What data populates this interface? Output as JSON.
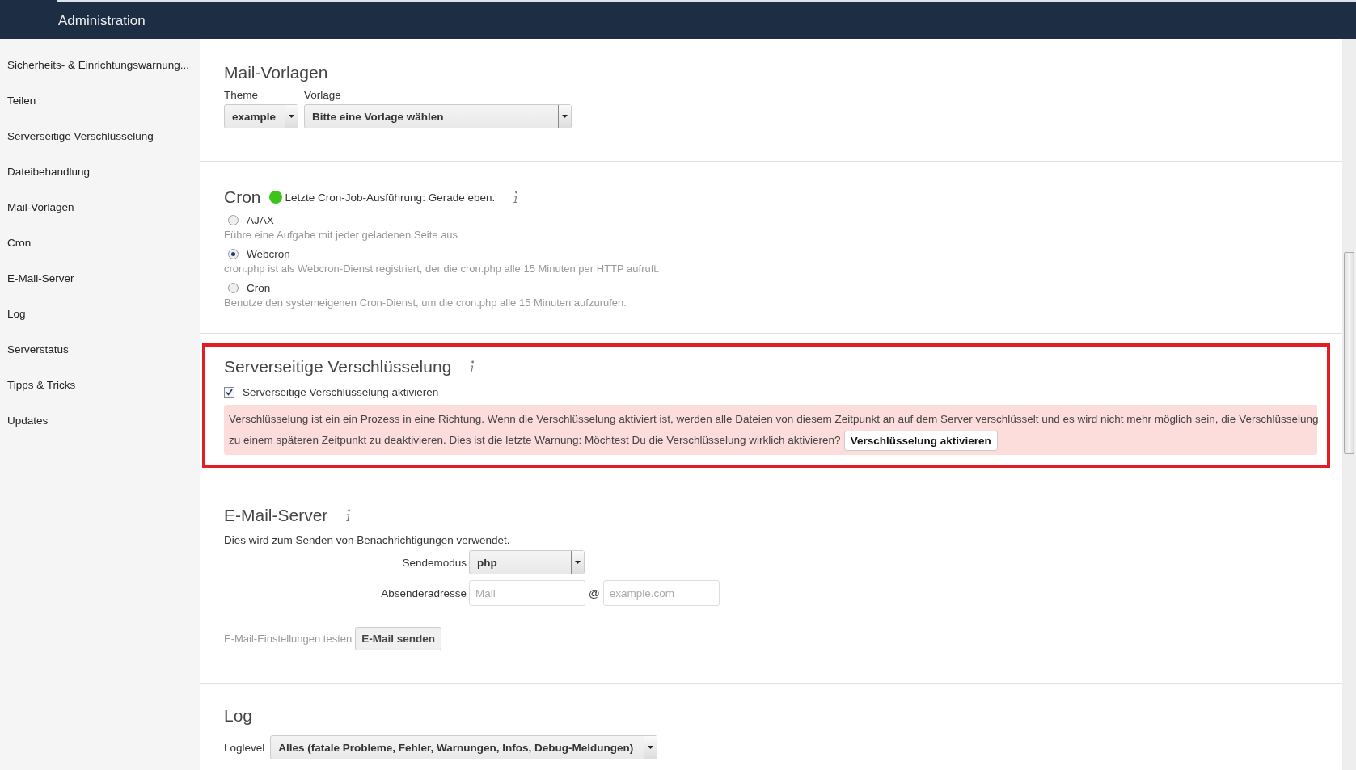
{
  "header": {
    "title": "Administration"
  },
  "sidebar": {
    "items": [
      {
        "label": "Sicherheits- & Einrichtungswarnung..."
      },
      {
        "label": "Teilen"
      },
      {
        "label": "Serverseitige Verschlüsselung"
      },
      {
        "label": "Dateibehandlung"
      },
      {
        "label": "Mail-Vorlagen"
      },
      {
        "label": "Cron"
      },
      {
        "label": "E-Mail-Server"
      },
      {
        "label": "Log"
      },
      {
        "label": "Serverstatus"
      },
      {
        "label": "Tipps & Tricks"
      },
      {
        "label": "Updates"
      }
    ]
  },
  "mail_templates": {
    "title": "Mail-Vorlagen",
    "theme": {
      "label": "Theme",
      "value": "example"
    },
    "template": {
      "label": "Vorlage",
      "value": "Bitte eine Vorlage wählen"
    }
  },
  "cron": {
    "title": "Cron",
    "status": {
      "ok": true,
      "text": "Letzte Cron-Job-Ausführung: Gerade eben."
    },
    "options": [
      {
        "label": "AJAX",
        "description": "Führe eine Aufgabe mit jeder geladenen Seite aus",
        "selected": false
      },
      {
        "label": "Webcron",
        "description": "cron.php ist als Webcron-Dienst registriert, der die cron.php alle 15 Minuten per HTTP aufruft.",
        "selected": true
      },
      {
        "label": "Cron",
        "description": "Benutze den systemeigenen Cron-Dienst, um die cron.php alle 15 Minuten aufzurufen.",
        "selected": false
      }
    ]
  },
  "encryption": {
    "title": "Serverseitige Verschlüsselung",
    "highlighted": true,
    "enable": {
      "label": "Serverseitige Verschlüsselung aktivieren",
      "checked": true
    },
    "warning_lines": [
      "Verschlüsselung ist ein ein Prozess in eine Richtung. Wenn die Verschlüsselung aktiviert ist, werden alle Dateien von diesem Zeitpunkt an auf dem Server verschlüsselt und es wird nicht mehr möglich sein, die Verschlüsselung",
      "zu einem späteren Zeitpunkt zu deaktivieren. Dies ist die letzte Warnung: Möchtest Du die Verschlüsselung wirklich aktivieren?"
    ],
    "button": "Verschlüsselung aktivieren"
  },
  "email_server": {
    "title": "E-Mail-Server",
    "description": "Dies wird zum Senden von Benachrichtigungen verwendet.",
    "send_mode": {
      "label": "Sendemodus",
      "value": "php"
    },
    "sender": {
      "label": "Absenderadresse",
      "mail_placeholder": "Mail",
      "at": "@",
      "domain_placeholder": "example.com"
    },
    "test": {
      "label": "E-Mail-Einstellungen testen",
      "button": "E-Mail senden"
    }
  },
  "log": {
    "title": "Log",
    "level": {
      "label": "Loglevel",
      "value": "Alles (fatale Probleme, Fehler, Warnungen, Infos, Debug-Meldungen)"
    }
  }
}
